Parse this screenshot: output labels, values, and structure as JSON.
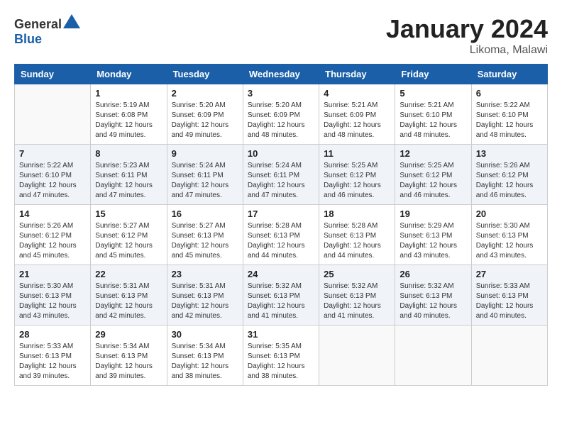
{
  "header": {
    "logo_general": "General",
    "logo_blue": "Blue",
    "month_title": "January 2024",
    "location": "Likoma, Malawi"
  },
  "days_of_week": [
    "Sunday",
    "Monday",
    "Tuesday",
    "Wednesday",
    "Thursday",
    "Friday",
    "Saturday"
  ],
  "weeks": [
    [
      {
        "day": "",
        "info": ""
      },
      {
        "day": "1",
        "info": "Sunrise: 5:19 AM\nSunset: 6:08 PM\nDaylight: 12 hours\nand 49 minutes."
      },
      {
        "day": "2",
        "info": "Sunrise: 5:20 AM\nSunset: 6:09 PM\nDaylight: 12 hours\nand 49 minutes."
      },
      {
        "day": "3",
        "info": "Sunrise: 5:20 AM\nSunset: 6:09 PM\nDaylight: 12 hours\nand 48 minutes."
      },
      {
        "day": "4",
        "info": "Sunrise: 5:21 AM\nSunset: 6:09 PM\nDaylight: 12 hours\nand 48 minutes."
      },
      {
        "day": "5",
        "info": "Sunrise: 5:21 AM\nSunset: 6:10 PM\nDaylight: 12 hours\nand 48 minutes."
      },
      {
        "day": "6",
        "info": "Sunrise: 5:22 AM\nSunset: 6:10 PM\nDaylight: 12 hours\nand 48 minutes."
      }
    ],
    [
      {
        "day": "7",
        "info": "Sunrise: 5:22 AM\nSunset: 6:10 PM\nDaylight: 12 hours\nand 47 minutes."
      },
      {
        "day": "8",
        "info": "Sunrise: 5:23 AM\nSunset: 6:11 PM\nDaylight: 12 hours\nand 47 minutes."
      },
      {
        "day": "9",
        "info": "Sunrise: 5:24 AM\nSunset: 6:11 PM\nDaylight: 12 hours\nand 47 minutes."
      },
      {
        "day": "10",
        "info": "Sunrise: 5:24 AM\nSunset: 6:11 PM\nDaylight: 12 hours\nand 47 minutes."
      },
      {
        "day": "11",
        "info": "Sunrise: 5:25 AM\nSunset: 6:12 PM\nDaylight: 12 hours\nand 46 minutes."
      },
      {
        "day": "12",
        "info": "Sunrise: 5:25 AM\nSunset: 6:12 PM\nDaylight: 12 hours\nand 46 minutes."
      },
      {
        "day": "13",
        "info": "Sunrise: 5:26 AM\nSunset: 6:12 PM\nDaylight: 12 hours\nand 46 minutes."
      }
    ],
    [
      {
        "day": "14",
        "info": "Sunrise: 5:26 AM\nSunset: 6:12 PM\nDaylight: 12 hours\nand 45 minutes."
      },
      {
        "day": "15",
        "info": "Sunrise: 5:27 AM\nSunset: 6:12 PM\nDaylight: 12 hours\nand 45 minutes."
      },
      {
        "day": "16",
        "info": "Sunrise: 5:27 AM\nSunset: 6:13 PM\nDaylight: 12 hours\nand 45 minutes."
      },
      {
        "day": "17",
        "info": "Sunrise: 5:28 AM\nSunset: 6:13 PM\nDaylight: 12 hours\nand 44 minutes."
      },
      {
        "day": "18",
        "info": "Sunrise: 5:28 AM\nSunset: 6:13 PM\nDaylight: 12 hours\nand 44 minutes."
      },
      {
        "day": "19",
        "info": "Sunrise: 5:29 AM\nSunset: 6:13 PM\nDaylight: 12 hours\nand 43 minutes."
      },
      {
        "day": "20",
        "info": "Sunrise: 5:30 AM\nSunset: 6:13 PM\nDaylight: 12 hours\nand 43 minutes."
      }
    ],
    [
      {
        "day": "21",
        "info": "Sunrise: 5:30 AM\nSunset: 6:13 PM\nDaylight: 12 hours\nand 43 minutes."
      },
      {
        "day": "22",
        "info": "Sunrise: 5:31 AM\nSunset: 6:13 PM\nDaylight: 12 hours\nand 42 minutes."
      },
      {
        "day": "23",
        "info": "Sunrise: 5:31 AM\nSunset: 6:13 PM\nDaylight: 12 hours\nand 42 minutes."
      },
      {
        "day": "24",
        "info": "Sunrise: 5:32 AM\nSunset: 6:13 PM\nDaylight: 12 hours\nand 41 minutes."
      },
      {
        "day": "25",
        "info": "Sunrise: 5:32 AM\nSunset: 6:13 PM\nDaylight: 12 hours\nand 41 minutes."
      },
      {
        "day": "26",
        "info": "Sunrise: 5:32 AM\nSunset: 6:13 PM\nDaylight: 12 hours\nand 40 minutes."
      },
      {
        "day": "27",
        "info": "Sunrise: 5:33 AM\nSunset: 6:13 PM\nDaylight: 12 hours\nand 40 minutes."
      }
    ],
    [
      {
        "day": "28",
        "info": "Sunrise: 5:33 AM\nSunset: 6:13 PM\nDaylight: 12 hours\nand 39 minutes."
      },
      {
        "day": "29",
        "info": "Sunrise: 5:34 AM\nSunset: 6:13 PM\nDaylight: 12 hours\nand 39 minutes."
      },
      {
        "day": "30",
        "info": "Sunrise: 5:34 AM\nSunset: 6:13 PM\nDaylight: 12 hours\nand 38 minutes."
      },
      {
        "day": "31",
        "info": "Sunrise: 5:35 AM\nSunset: 6:13 PM\nDaylight: 12 hours\nand 38 minutes."
      },
      {
        "day": "",
        "info": ""
      },
      {
        "day": "",
        "info": ""
      },
      {
        "day": "",
        "info": ""
      }
    ]
  ]
}
